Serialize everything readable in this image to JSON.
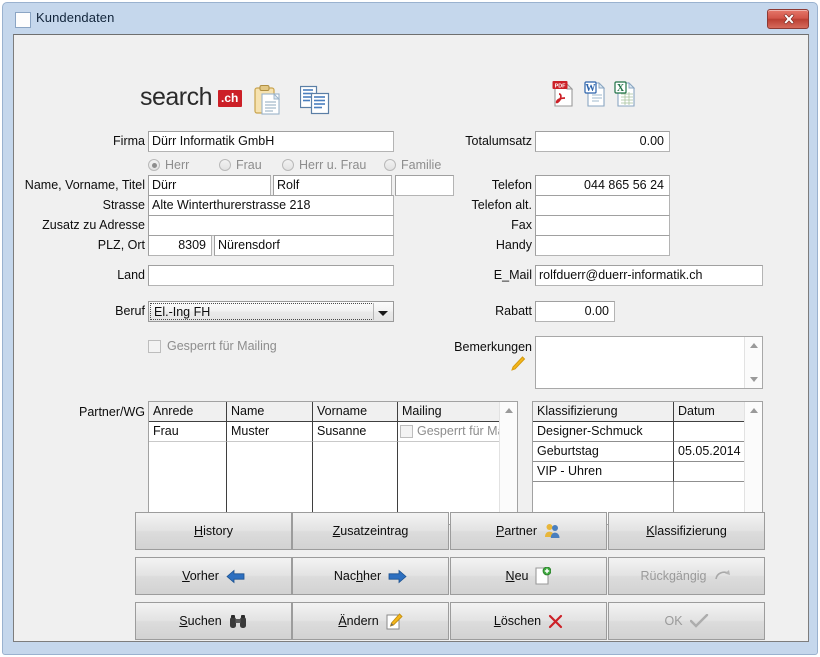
{
  "window": {
    "title": "Kundendaten",
    "close_label": "Close",
    "icon": "window-icon",
    "frame_color": "#c5d7ec",
    "client_bg": "#f0f0f0"
  },
  "branding": {
    "logo_text": "search",
    "logo_suffix": ".ch",
    "logo_accent": "#cc2027",
    "clipboard_icon": "clipboard-icon",
    "copy_icon": "copy-documents-icon"
  },
  "export": {
    "pdf_label": "PDF",
    "word_label": "W",
    "excel_label": "X"
  },
  "form": {
    "firma": {
      "label": "Firma",
      "value": "Dürr Informatik GmbH"
    },
    "anrede": {
      "options": [
        "Herr",
        "Frau",
        "Herr u. Frau",
        "Familie"
      ],
      "selected": "Herr"
    },
    "name": {
      "label": "Name, Vorname, Titel",
      "nachname": "Dürr",
      "vorname": "Rolf",
      "titel": ""
    },
    "strasse": {
      "label": "Strasse",
      "value": "Alte Winterthurerstrasse 218"
    },
    "zusatz": {
      "label": "Zusatz zu Adresse",
      "value": ""
    },
    "plz_ort": {
      "label": "PLZ, Ort",
      "plz": "8309",
      "ort": "Nürensdorf"
    },
    "land": {
      "label": "Land",
      "value": ""
    },
    "beruf": {
      "label": "Beruf",
      "value": "El.-Ing FH"
    },
    "gesperrt": {
      "label": "Gesperrt für Mailing",
      "checked": false
    },
    "totalumsatz": {
      "label": "Totalumsatz",
      "value": "0.00"
    },
    "telefon": {
      "label": "Telefon",
      "value": "044 865 56 24"
    },
    "telefon_alt": {
      "label": "Telefon alt.",
      "value": ""
    },
    "fax": {
      "label": "Fax",
      "value": ""
    },
    "handy": {
      "label": "Handy",
      "value": ""
    },
    "email": {
      "label": "E_Mail",
      "value": "rolfduerr@duerr-informatik.ch"
    },
    "rabatt": {
      "label": "Rabatt",
      "value": "0.00"
    },
    "bemerkungen": {
      "label": "Bemerkungen",
      "value": "",
      "icon": "pencil-icon"
    }
  },
  "partner_grid": {
    "label": "Partner/WG",
    "columns": [
      "Anrede",
      "Name",
      "Vorname",
      "Mailing"
    ],
    "rows": [
      {
        "anrede": "Frau",
        "name": "Muster",
        "vorname": "Susanne",
        "mailing": "Gesperrt für Mailing",
        "mailing_checked": false
      }
    ]
  },
  "klassifizierung_grid": {
    "columns": [
      "Klassifizierung",
      "Datum"
    ],
    "rows": [
      {
        "klassifizierung": "Designer-Schmuck",
        "datum": ""
      },
      {
        "klassifizierung": "Geburtstag",
        "datum": "05.05.2014"
      },
      {
        "klassifizierung": "VIP - Uhren",
        "datum": ""
      }
    ]
  },
  "buttons": [
    {
      "id": "history",
      "pre": "H",
      "post": "istory",
      "icon": "none",
      "enabled": true
    },
    {
      "id": "zusatzeintrag",
      "pre": "Z",
      "post": "usatzeintrag",
      "icon": "none",
      "enabled": true
    },
    {
      "id": "partner",
      "pre": "P",
      "post": "artner",
      "icon": "people-icon",
      "enabled": true
    },
    {
      "id": "klassifizierung",
      "pre": "K",
      "post": "lassifizierung",
      "icon": "none",
      "enabled": true
    },
    {
      "id": "vorher",
      "pre": "V",
      "post": "orher",
      "icon": "arrow-left-icon",
      "enabled": true
    },
    {
      "id": "nachher",
      "pre": "h",
      "post": "",
      "icon": "arrow-right-icon",
      "enabled": true,
      "full": "Nachher"
    },
    {
      "id": "neu",
      "pre": "N",
      "post": "eu",
      "icon": "new-doc-icon",
      "enabled": true
    },
    {
      "id": "rueckgaengig",
      "pre": "R",
      "post": "ückgängig",
      "icon": "undo-icon",
      "enabled": false
    },
    {
      "id": "suchen",
      "pre": "S",
      "post": "uchen",
      "icon": "binoculars-icon",
      "enabled": true
    },
    {
      "id": "aendern",
      "pre": "Ä",
      "post": "ndern",
      "icon": "pencil-edit-icon",
      "enabled": true
    },
    {
      "id": "loeschen",
      "pre": "L",
      "post": "öschen",
      "icon": "red-x-icon",
      "enabled": true
    },
    {
      "id": "ok",
      "pre": "",
      "post": "OK",
      "icon": "check-icon",
      "enabled": false
    }
  ],
  "button_labels": {
    "history": "History",
    "zusatzeintrag": "Zusatzeintrag",
    "partner": "Partner",
    "klassifizierung": "Klassifizierung",
    "vorher": "Vorher",
    "nachher": "Nachher",
    "neu": "Neu",
    "rueckgaengig": "Rückgängig",
    "suchen": "Suchen",
    "aendern": "Ändern",
    "loeschen": "Löschen",
    "ok": "OK"
  }
}
